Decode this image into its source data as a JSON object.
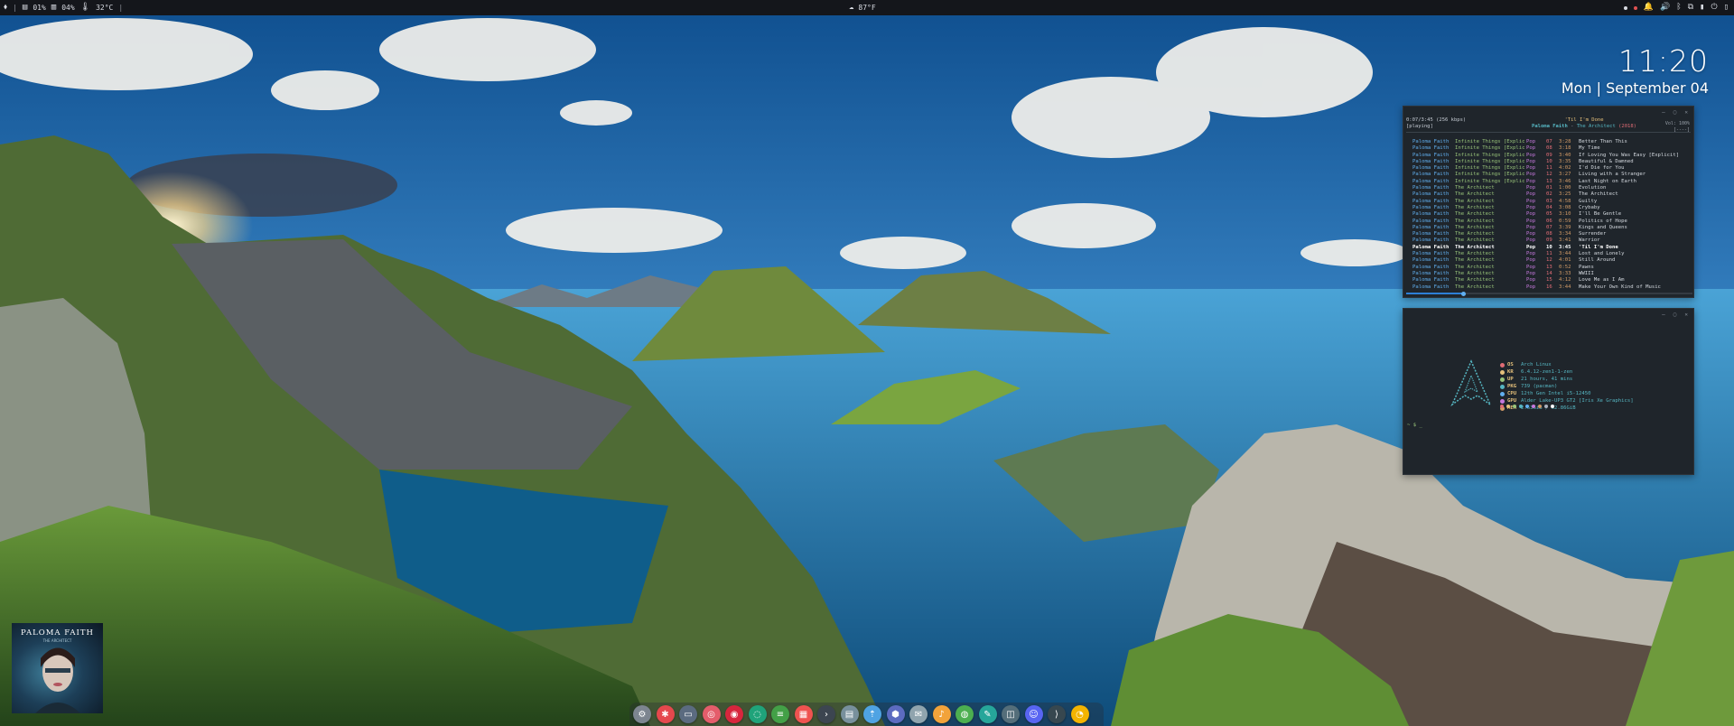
{
  "topbar": {
    "workspace_glyph": "☰",
    "ram": "01%",
    "swap": "04%",
    "temp": "32°C",
    "weather_temp": "87°F",
    "weather_icon": "cloud-icon"
  },
  "clock": {
    "time": "11:20",
    "date": "Mon | September 04"
  },
  "music": {
    "status": "[playing]",
    "elapsed": "0:07/3:45 (256 kbps)",
    "now_title": "'Til I'm Done",
    "now_artist": "Paloma Faith",
    "now_album": "The Architect",
    "now_year": "(2018)",
    "vol": "Vol: 100%",
    "flags": "[----]",
    "progress_fraction": 0.2,
    "tracks": [
      {
        "artist": "Paloma Faith",
        "album": "Infinite Things [Explic",
        "genre": "Pop",
        "year": "07",
        "length": "3:28",
        "title": "Better Than This"
      },
      {
        "artist": "Paloma Faith",
        "album": "Infinite Things [Explic",
        "genre": "Pop",
        "year": "08",
        "length": "3:18",
        "title": "My Time"
      },
      {
        "artist": "Paloma Faith",
        "album": "Infinite Things [Explic",
        "genre": "Pop",
        "year": "09",
        "length": "3:40",
        "title": "If Loving You Was Easy [Explicit]"
      },
      {
        "artist": "Paloma Faith",
        "album": "Infinite Things [Explic",
        "genre": "Pop",
        "year": "10",
        "length": "3:35",
        "title": "Beautiful & Damned"
      },
      {
        "artist": "Paloma Faith",
        "album": "Infinite Things [Explic",
        "genre": "Pop",
        "year": "11",
        "length": "4:02",
        "title": "I'd Die for You"
      },
      {
        "artist": "Paloma Faith",
        "album": "Infinite Things [Explic",
        "genre": "Pop",
        "year": "12",
        "length": "3:27",
        "title": "Living with a Stranger"
      },
      {
        "artist": "Paloma Faith",
        "album": "Infinite Things [Explic",
        "genre": "Pop",
        "year": "13",
        "length": "3:46",
        "title": "Last Night on Earth"
      },
      {
        "artist": "Paloma Faith",
        "album": "The Architect",
        "genre": "Pop",
        "year": "01",
        "length": "1:00",
        "title": "Evolution"
      },
      {
        "artist": "Paloma Faith",
        "album": "The Architect",
        "genre": "Pop",
        "year": "02",
        "length": "3:25",
        "title": "The Architect"
      },
      {
        "artist": "Paloma Faith",
        "album": "The Architect",
        "genre": "Pop",
        "year": "03",
        "length": "4:58",
        "title": "Guilty"
      },
      {
        "artist": "Paloma Faith",
        "album": "The Architect",
        "genre": "Pop",
        "year": "04",
        "length": "3:08",
        "title": "Crybaby"
      },
      {
        "artist": "Paloma Faith",
        "album": "The Architect",
        "genre": "Pop",
        "year": "05",
        "length": "3:10",
        "title": "I'll Be Gentle"
      },
      {
        "artist": "Paloma Faith",
        "album": "The Architect",
        "genre": "Pop",
        "year": "06",
        "length": "0:59",
        "title": "Politics of Hope"
      },
      {
        "artist": "Paloma Faith",
        "album": "The Architect",
        "genre": "Pop",
        "year": "07",
        "length": "3:39",
        "title": "Kings and Queens"
      },
      {
        "artist": "Paloma Faith",
        "album": "The Architect",
        "genre": "Pop",
        "year": "08",
        "length": "3:34",
        "title": "Surrender"
      },
      {
        "artist": "Paloma Faith",
        "album": "The Architect",
        "genre": "Pop",
        "year": "09",
        "length": "3:41",
        "title": "Warrior"
      },
      {
        "artist": "Paloma Faith",
        "album": "The Architect",
        "genre": "Pop",
        "year": "10",
        "length": "3:45",
        "title": "'Til I'm Done"
      },
      {
        "artist": "Paloma Faith",
        "album": "The Architect",
        "genre": "Pop",
        "year": "11",
        "length": "3:44",
        "title": "Lost and Lonely"
      },
      {
        "artist": "Paloma Faith",
        "album": "The Architect",
        "genre": "Pop",
        "year": "12",
        "length": "4:01",
        "title": "Still Around"
      },
      {
        "artist": "Paloma Faith",
        "album": "The Architect",
        "genre": "Pop",
        "year": "13",
        "length": "0:52",
        "title": "Pawns"
      },
      {
        "artist": "Paloma Faith",
        "album": "The Architect",
        "genre": "Pop",
        "year": "14",
        "length": "3:33",
        "title": "WWIII"
      },
      {
        "artist": "Paloma Faith",
        "album": "The Architect",
        "genre": "Pop",
        "year": "15",
        "length": "4:12",
        "title": "Love Me as I Am"
      },
      {
        "artist": "Paloma Faith",
        "album": "The Architect",
        "genre": "Pop",
        "year": "16",
        "length": "3:44",
        "title": "Make Your Own Kind of Music"
      }
    ],
    "playing_index": 16
  },
  "fetch": {
    "rows": [
      {
        "key": "OS",
        "value": "Arch Linux",
        "color": "#e06c75"
      },
      {
        "key": "KR",
        "value": "6.4.12-zen1-1-zen",
        "color": "#e5c07b"
      },
      {
        "key": "UP",
        "value": "21 hours, 41 mins",
        "color": "#98c379"
      },
      {
        "key": "PKG",
        "value": "739 (pacman)",
        "color": "#56b6c2"
      },
      {
        "key": "CPU",
        "value": "12th Gen Intel i5-12450",
        "color": "#61afef"
      },
      {
        "key": "GPU",
        "value": "Alder Lake-UP3 GT2 [Iris Xe Graphics]",
        "color": "#c678dd"
      },
      {
        "key": "MEM",
        "value": "2.63GiB / 62.86GiB",
        "color": "#d19a66"
      }
    ],
    "palette": [
      "#e06c75",
      "#e5c07b",
      "#98c379",
      "#56b6c2",
      "#61afef",
      "#c678dd",
      "#d19a66",
      "#abb2bf",
      "#ffffff"
    ],
    "prompt": "~ $ _"
  },
  "album_art": {
    "title": "PALOMA FAITH",
    "subtitle": "THE ARCHITECT"
  },
  "dock": [
    {
      "name": "settings-icon",
      "color": "#7d8590",
      "glyph": "⚙"
    },
    {
      "name": "app-red-gear-icon",
      "color": "#e5484d",
      "glyph": "✱"
    },
    {
      "name": "screen-icon",
      "color": "#5b6b80",
      "glyph": "▭"
    },
    {
      "name": "search-app-icon",
      "color": "#e45d6b",
      "glyph": "◎"
    },
    {
      "name": "debian-icon",
      "color": "#d7263d",
      "glyph": "◉"
    },
    {
      "name": "browser-icon",
      "color": "#1fa37a",
      "glyph": "◌"
    },
    {
      "name": "stack-icon",
      "color": "#43a047",
      "glyph": "≡"
    },
    {
      "name": "calendar-icon",
      "color": "#ef5350",
      "glyph": "▦"
    },
    {
      "name": "terminal-icon",
      "color": "#3c4550",
      "glyph": "›"
    },
    {
      "name": "files-icon",
      "color": "#78909c",
      "glyph": "▤"
    },
    {
      "name": "upload-icon",
      "color": "#4fa3e3",
      "glyph": "⇡"
    },
    {
      "name": "shield-icon",
      "color": "#5c6bc0",
      "glyph": "⬢"
    },
    {
      "name": "mail-icon",
      "color": "#90a4ae",
      "glyph": "✉"
    },
    {
      "name": "music-icon",
      "color": "#f2a33a",
      "glyph": "♪"
    },
    {
      "name": "maps-icon",
      "color": "#4caf50",
      "glyph": "◍"
    },
    {
      "name": "feather-icon",
      "color": "#26a69a",
      "glyph": "✎"
    },
    {
      "name": "monitor-icon",
      "color": "#546e7a",
      "glyph": "◫"
    },
    {
      "name": "discord-icon",
      "color": "#5865f2",
      "glyph": "☺"
    },
    {
      "name": "code-icon",
      "color": "#37474f",
      "glyph": "⟩"
    },
    {
      "name": "chrome-icon",
      "color": "#f4b400",
      "glyph": "◔"
    }
  ]
}
